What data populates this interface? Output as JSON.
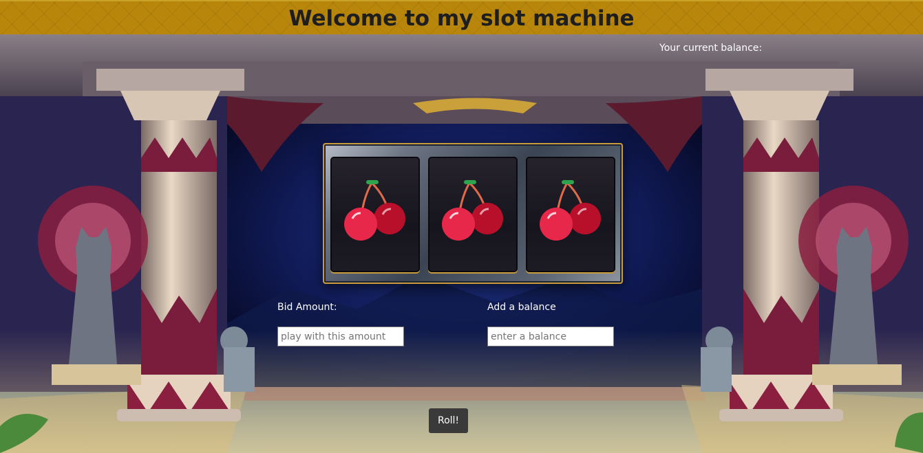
{
  "header": {
    "title": "Welcome to my slot machine"
  },
  "balance": {
    "label": "Your current balance:"
  },
  "reels": [
    {
      "symbol": "cherry-icon"
    },
    {
      "symbol": "cherry-icon"
    },
    {
      "symbol": "cherry-icon"
    }
  ],
  "bid": {
    "label": "Bid Amount:",
    "placeholder": "play with this amount",
    "value": ""
  },
  "add_balance": {
    "label": "Add a balance",
    "placeholder": "enter a balance",
    "value": ""
  },
  "roll_button": {
    "label": "Roll!"
  },
  "colors": {
    "header_gold": "#b8860b",
    "cherry_red": "#e8284a",
    "stem_green": "#2ea44f",
    "button_dark": "#3a3a3a",
    "sky_blue": "#0b1240"
  }
}
